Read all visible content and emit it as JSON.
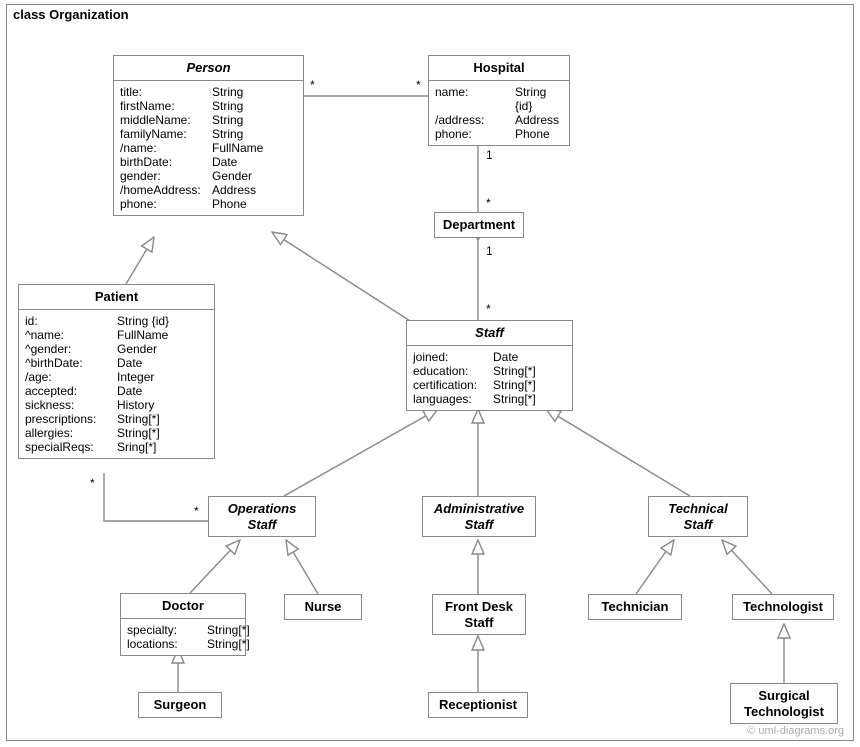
{
  "package": {
    "name": "class Organization"
  },
  "classes": {
    "person": {
      "name": "Person",
      "attrs": [
        [
          "title:",
          "String"
        ],
        [
          "firstName:",
          "String"
        ],
        [
          "middleName:",
          "String"
        ],
        [
          "familyName:",
          "String"
        ],
        [
          "/name:",
          "FullName"
        ],
        [
          "birthDate:",
          "Date"
        ],
        [
          "gender:",
          "Gender"
        ],
        [
          "/homeAddress:",
          "Address"
        ],
        [
          "phone:",
          "Phone"
        ]
      ]
    },
    "hospital": {
      "name": "Hospital",
      "attrs": [
        [
          "name:",
          "String {id}"
        ],
        [
          "/address:",
          "Address"
        ],
        [
          "phone:",
          "Phone"
        ]
      ]
    },
    "department": {
      "name": "Department",
      "attrs": []
    },
    "patient": {
      "name": "Patient",
      "attrs": [
        [
          "id:",
          "String {id}"
        ],
        [
          "^name:",
          "FullName"
        ],
        [
          "^gender:",
          "Gender"
        ],
        [
          "^birthDate:",
          "Date"
        ],
        [
          "/age:",
          "Integer"
        ],
        [
          "accepted:",
          "Date"
        ],
        [
          "sickness:",
          "History"
        ],
        [
          "prescriptions:",
          "String[*]"
        ],
        [
          "allergies:",
          "String[*]"
        ],
        [
          "specialReqs:",
          "Sring[*]"
        ]
      ]
    },
    "staff": {
      "name": "Staff",
      "attrs": [
        [
          "joined:",
          "Date"
        ],
        [
          "education:",
          "String[*]"
        ],
        [
          "certification:",
          "String[*]"
        ],
        [
          "languages:",
          "String[*]"
        ]
      ]
    },
    "operations_staff": {
      "name": "Operations\nStaff",
      "attrs": []
    },
    "administrative_staff": {
      "name": "Administrative\nStaff",
      "attrs": []
    },
    "technical_staff": {
      "name": "Technical\nStaff",
      "attrs": []
    },
    "doctor": {
      "name": "Doctor",
      "attrs": [
        [
          "specialty:",
          "String[*]"
        ],
        [
          "locations:",
          "String[*]"
        ]
      ]
    },
    "nurse": {
      "name": "Nurse",
      "attrs": []
    },
    "front_desk_staff": {
      "name": "Front Desk\nStaff",
      "attrs": []
    },
    "technician": {
      "name": "Technician",
      "attrs": []
    },
    "technologist": {
      "name": "Technologist",
      "attrs": []
    },
    "surgeon": {
      "name": "Surgeon",
      "attrs": []
    },
    "receptionist": {
      "name": "Receptionist",
      "attrs": []
    },
    "surgical_technologist": {
      "name": "Surgical\nTechnologist",
      "attrs": []
    }
  },
  "multiplicities": {
    "person_hospital_l": "*",
    "person_hospital_r": "*",
    "hospital_dept_top": "1",
    "hospital_dept_bot": "*",
    "dept_staff_top": "1",
    "dept_staff_bot": "*",
    "patient_ops_l": "*",
    "patient_ops_r": "*"
  },
  "watermark": "© uml-diagrams.org"
}
